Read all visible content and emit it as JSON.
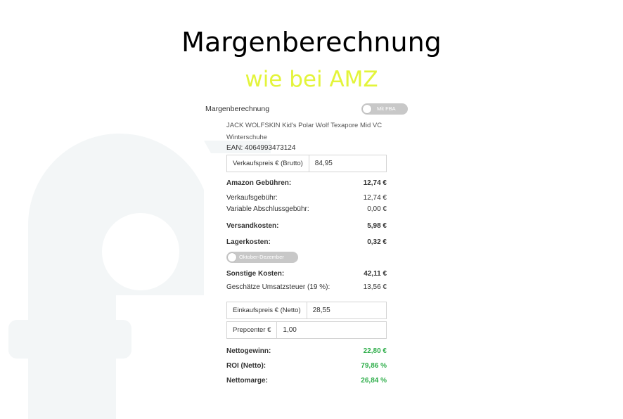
{
  "header": {
    "title": "Margenberechnung",
    "subtitle": "wie bei AMZ"
  },
  "panel": {
    "heading": "Margenberechnung",
    "fba_toggle": {
      "label": "Mit FBA",
      "on": false
    },
    "product": {
      "name": "JACK WOLFSKIN Kid's Polar Wolf Texapore Mid VC Winterschuhe",
      "ean": "EAN: 4064993473124"
    },
    "sale_price": {
      "label": "Verkaufspreis € (Brutto)",
      "value": "84,95"
    },
    "amazon_fees": {
      "label": "Amazon Gebühren:",
      "value": "12,74 €"
    },
    "sales_fee": {
      "label": "Verkaufsgebühr:",
      "value": "12,74 €"
    },
    "variable_closing_fee": {
      "label": "Variable Abschlussgebühr:",
      "value": "0,00 €"
    },
    "shipping_costs": {
      "label": "Versandkosten:",
      "value": "5,98 €"
    },
    "storage_costs": {
      "label": "Lagerkosten:",
      "value": "0,32 €"
    },
    "season_toggle": {
      "label": "Oktober-Dezember",
      "on": false
    },
    "other_costs": {
      "label": "Sonstige Kosten:",
      "value": "42,11 €"
    },
    "vat": {
      "label": "Geschätze Umsatzsteuer (19 %):",
      "value": "13,56 €"
    },
    "purchase_price": {
      "label": "Einkaufspreis € (Netto)",
      "value": "28,55"
    },
    "prepcenter": {
      "label": "Prepcenter €",
      "value": "1,00"
    },
    "net_profit": {
      "label": "Nettogewinn:",
      "value": "22,80 €"
    },
    "roi": {
      "label": "ROI (Netto):",
      "value": "79,86 %"
    },
    "net_margin": {
      "label": "Nettomarge:",
      "value": "26,84 %"
    }
  },
  "colors": {
    "subtitle": "#e3f43a",
    "positive": "#2fae4b",
    "toggle_off": "#c8c8c8",
    "logo_watermark": "#f3f6f7"
  },
  "icons": {
    "background": "brand-logo-watermark"
  }
}
